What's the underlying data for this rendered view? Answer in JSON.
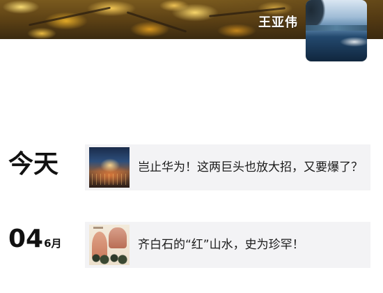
{
  "profile": {
    "name": "王亚伟",
    "avatar_icon": "lake-landscape-avatar",
    "cover_icon": "autumn-leaves-cover"
  },
  "feed": [
    {
      "date_label": "今天",
      "posts": [
        {
          "title": "岂止华为！这两巨头也放大招，又要爆了？",
          "thumbnail_icon": "tech-city-thumbnail"
        }
      ]
    },
    {
      "date_day": "04",
      "date_month": "6月",
      "posts": [
        {
          "title": "齐白石的“红”山水，史为珍罕！",
          "thumbnail_icon": "landscape-painting-thumbnail"
        }
      ]
    }
  ],
  "colors": {
    "text_primary": "#111111",
    "card_background": "#f3f3f5",
    "page_background": "#ffffff"
  }
}
